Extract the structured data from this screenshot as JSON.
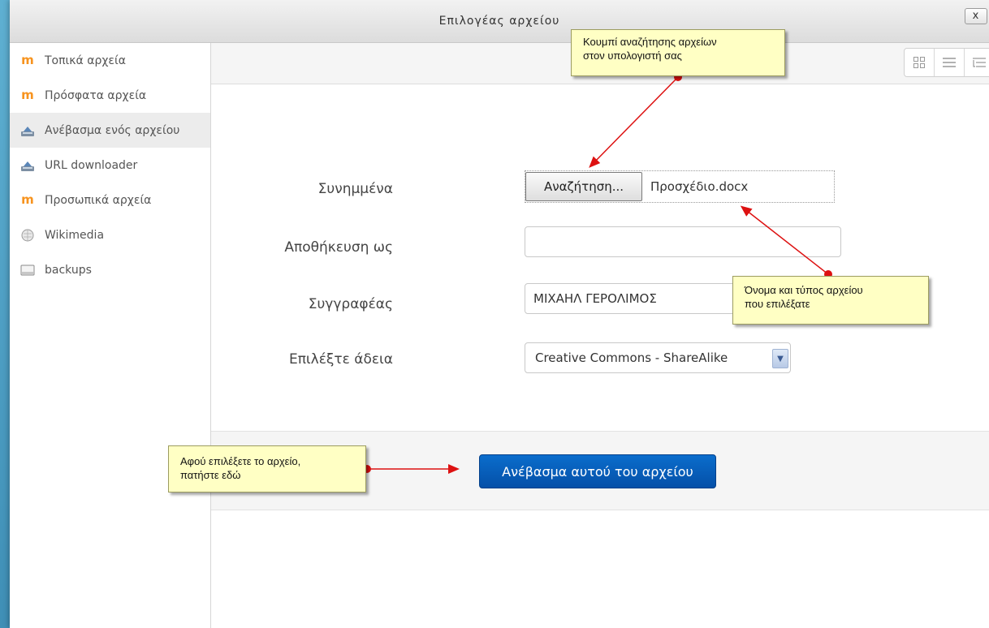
{
  "dialog": {
    "title": "Επιλογέας αρχείου",
    "close_label": "x"
  },
  "sidebar": {
    "items": [
      {
        "label": "Τοπικά αρχεία",
        "icon": "moodle-icon",
        "active": false
      },
      {
        "label": "Πρόσφατα αρχεία",
        "icon": "moodle-icon",
        "active": false
      },
      {
        "label": "Ανέβασμα ενός αρχείου",
        "icon": "upload-icon",
        "active": true
      },
      {
        "label": "URL downloader",
        "icon": "upload-icon",
        "active": false
      },
      {
        "label": "Προσωπικά αρχεία",
        "icon": "moodle-icon",
        "active": false
      },
      {
        "label": "Wikimedia",
        "icon": "wikimedia-globe-icon",
        "active": false
      },
      {
        "label": "backups",
        "icon": "backup-drive-icon",
        "active": false
      }
    ]
  },
  "toolbar": {
    "views": [
      "grid-view-icon",
      "list-view-icon",
      "tree-view-icon"
    ]
  },
  "form": {
    "attachment_label": "Συνημμένα",
    "browse_label": "Αναζήτηση...",
    "file_name": "Προσχέδιο.docx",
    "save_as_label": "Αποθήκευση ως",
    "save_as_value": "",
    "author_label": "Συγγραφέας",
    "author_value": "ΜΙΧΑΗΛ ΓΕΡΟΛΙΜΟΣ",
    "license_label": "Επιλέξτε άδεια",
    "license_value": "Creative Commons - ShareAlike",
    "upload_label": "Ανέβασμα αυτού του αρχείου"
  },
  "callouts": {
    "browse_note_line1": "Κουμπί αναζήτησης αρχείων",
    "browse_note_line2": "στον υπολογιστή σας",
    "file_note_line1": "Όνομα και τύπος αρχείου",
    "file_note_line2": "που επιλέξατε",
    "upload_note_line1": "Αφού επιλέξετε το αρχείο,",
    "upload_note_line2": "πατήστε εδώ"
  },
  "colors": {
    "accent": "#0a5fb8",
    "callout_bg": "#ffffc4",
    "arrow": "#dd1111",
    "moodle_orange": "#f7931e"
  }
}
